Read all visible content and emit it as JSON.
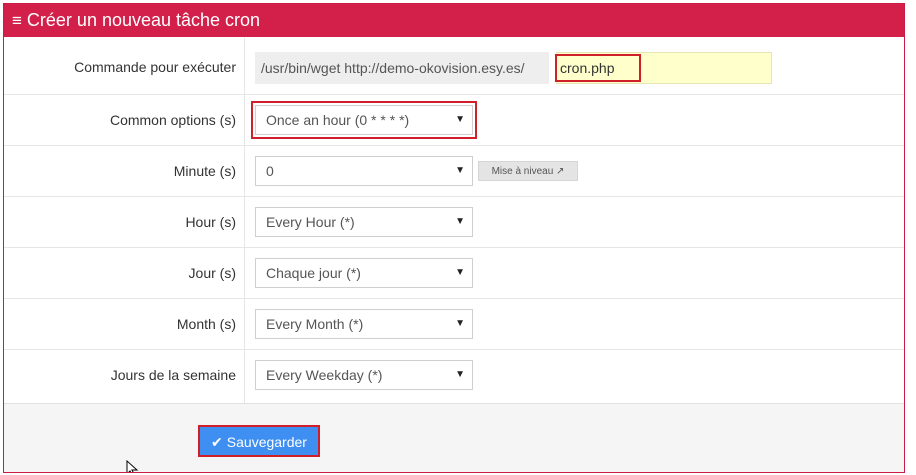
{
  "header": {
    "icon": "bars-icon",
    "title": "Créer un nouveau tâche cron"
  },
  "command": {
    "label": "Commande pour exécuter",
    "prefix": "/usr/bin/wget http://demo-okovision.esy.es/",
    "value": "cron.php"
  },
  "common": {
    "label": "Common options (s)",
    "value": "Once an hour (0 * * * *)"
  },
  "minute": {
    "label": "Minute (s)",
    "value": "0",
    "upgrade_label": "Mise à niveau"
  },
  "hour": {
    "label": "Hour (s)",
    "value": "Every Hour (*)"
  },
  "day": {
    "label": "Jour (s)",
    "value": "Chaque jour (*)"
  },
  "month": {
    "label": "Month (s)",
    "value": "Every Month (*)"
  },
  "weekday": {
    "label": "Jours de la semaine",
    "value": "Every Weekday (*)"
  },
  "actions": {
    "save_label": "Sauvegarder"
  },
  "colors": {
    "header": "#d2204a",
    "save": "#3f8ff2",
    "highlight": "#d11f2a",
    "input_bg": "#ffffcc"
  }
}
